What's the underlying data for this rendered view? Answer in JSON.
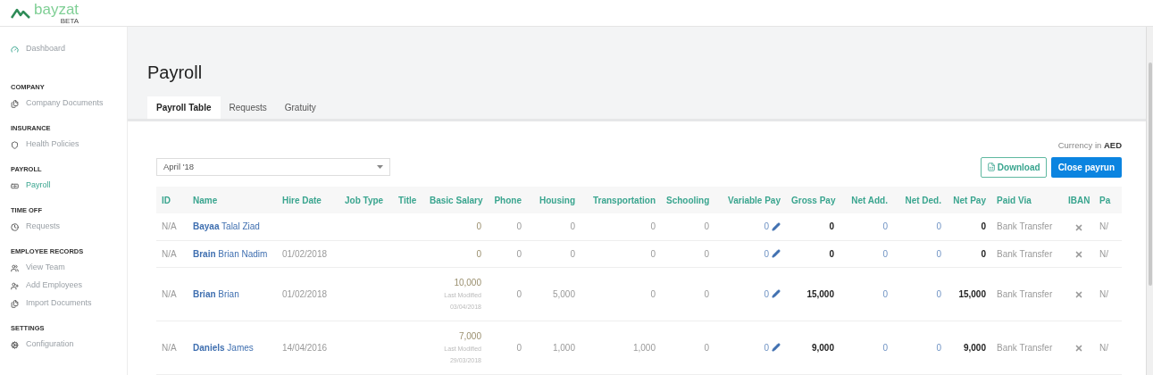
{
  "logo": {
    "name": "bayzat",
    "badge": "BETA"
  },
  "sidebar": {
    "top_item": {
      "label": "Dashboard",
      "kind": "dashboard",
      "selected": false
    },
    "sections": [
      {
        "title": "COMPANY",
        "items": [
          {
            "label": "Company Documents",
            "kind": "documents",
            "selected": false
          }
        ]
      },
      {
        "title": "INSURANCE",
        "items": [
          {
            "label": "Health Policies",
            "kind": "insurance",
            "selected": false
          }
        ]
      },
      {
        "title": "PAYROLL",
        "items": [
          {
            "label": "Payroll",
            "kind": "payroll",
            "selected": true
          }
        ]
      },
      {
        "title": "TIME OFF",
        "items": [
          {
            "label": "Requests",
            "kind": "timeoff",
            "selected": false
          }
        ]
      },
      {
        "title": "EMPLOYEE RECORDS",
        "items": [
          {
            "label": "View Team",
            "kind": "team",
            "selected": false
          },
          {
            "label": "Add Employees",
            "kind": "adduser",
            "selected": false
          },
          {
            "label": "Import Documents",
            "kind": "documents",
            "selected": false
          }
        ]
      },
      {
        "title": "SETTINGS",
        "items": [
          {
            "label": "Configuration",
            "kind": "settings",
            "selected": false
          }
        ]
      }
    ]
  },
  "page_title": "Payroll",
  "tabs": [
    {
      "label": "Payroll Table",
      "selected": true
    },
    {
      "label": "Requests",
      "selected": false
    },
    {
      "label": "Gratuity",
      "selected": false
    }
  ],
  "currency": {
    "label": "Currency in",
    "value": "AED"
  },
  "period_select": {
    "value": "April '18"
  },
  "buttons": {
    "download": "Download",
    "close": "Close payrun"
  },
  "table": {
    "columns": [
      "ID",
      "Name",
      "Hire Date",
      "Job Type",
      "Title",
      "Basic Salary",
      "Phone",
      "Housing",
      "Transportation",
      "Schooling",
      "Variable Pay",
      "Gross Pay",
      "Net Add.",
      "Net Ded.",
      "Net Pay",
      "Paid Via",
      "IBAN",
      "Pa"
    ],
    "rows": [
      {
        "id": "N/A",
        "last_name": "Bayaa",
        "first_names": "Talal Ziad",
        "hire_date": "",
        "basic_salary": "0",
        "modified_label": "",
        "modified_date": "",
        "phone": "0",
        "housing": "0",
        "transportation": "0",
        "schooling": "0",
        "variable_pay": "0",
        "gross_pay": "0",
        "net_add": "0",
        "net_ded": "0",
        "net_pay": "0",
        "paid_via": "Bank Transfer",
        "iban_provided": false,
        "column_18": "N/"
      },
      {
        "id": "N/A",
        "last_name": "Brain",
        "first_names": "Brian Nadim",
        "hire_date": "01/02/2018",
        "basic_salary": "0",
        "modified_label": "",
        "modified_date": "",
        "phone": "0",
        "housing": "0",
        "transportation": "0",
        "schooling": "0",
        "variable_pay": "0",
        "gross_pay": "0",
        "net_add": "0",
        "net_ded": "0",
        "net_pay": "0",
        "paid_via": "Bank Transfer",
        "iban_provided": false,
        "column_18": "N/"
      },
      {
        "id": "N/A",
        "last_name": "Brian",
        "first_names": "Brian",
        "hire_date": "01/02/2018",
        "basic_salary": "10,000",
        "modified_label": "Last Modified",
        "modified_date": "03/04/2018",
        "phone": "0",
        "housing": "5,000",
        "transportation": "0",
        "schooling": "0",
        "variable_pay": "0",
        "gross_pay": "15,000",
        "net_add": "0",
        "net_ded": "0",
        "net_pay": "15,000",
        "paid_via": "Bank Transfer",
        "iban_provided": false,
        "column_18": "N/"
      },
      {
        "id": "N/A",
        "last_name": "Daniels",
        "first_names": "James",
        "hire_date": "14/04/2016",
        "basic_salary": "7,000",
        "modified_label": "Last Modified",
        "modified_date": "29/03/2018",
        "phone": "0",
        "housing": "1,000",
        "transportation": "1,000",
        "schooling": "0",
        "variable_pay": "0",
        "gross_pay": "9,000",
        "net_add": "0",
        "net_ded": "0",
        "net_pay": "9,000",
        "paid_via": "Bank Transfer",
        "iban_provided": false,
        "column_18": "N/"
      }
    ]
  }
}
